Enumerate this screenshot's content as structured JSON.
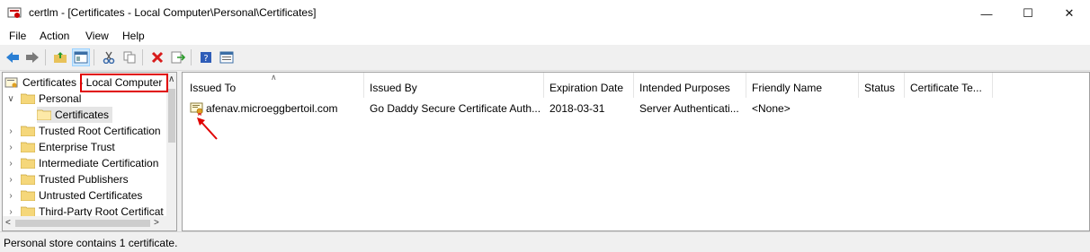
{
  "window": {
    "title": "certlm - [Certificates - Local Computer\\Personal\\Certificates]"
  },
  "menu": [
    "File",
    "Action",
    "View",
    "Help"
  ],
  "tree": {
    "root": "Certificates - Local Computer",
    "items": [
      {
        "label": "Personal",
        "expanded": true
      },
      {
        "label": "Certificates",
        "selected": true
      },
      {
        "label": "Trusted Root Certification"
      },
      {
        "label": "Enterprise Trust"
      },
      {
        "label": "Intermediate Certification"
      },
      {
        "label": "Trusted Publishers"
      },
      {
        "label": "Untrusted Certificates"
      },
      {
        "label": "Third-Party Root Certificat"
      }
    ]
  },
  "table": {
    "columns": [
      "Issued To",
      "Issued By",
      "Expiration Date",
      "Intended Purposes",
      "Friendly Name",
      "Status",
      "Certificate Te..."
    ],
    "rows": [
      [
        "afenav.microeggbertoil.com",
        "Go Daddy Secure Certificate Auth...",
        "2018-03-31",
        "Server Authenticati...",
        "<None>",
        "",
        ""
      ]
    ]
  },
  "status": "Personal store contains 1 certificate.",
  "colors": {
    "highlight": "#e00000",
    "arrow": "#e00000",
    "folder": "#f5d77a"
  }
}
